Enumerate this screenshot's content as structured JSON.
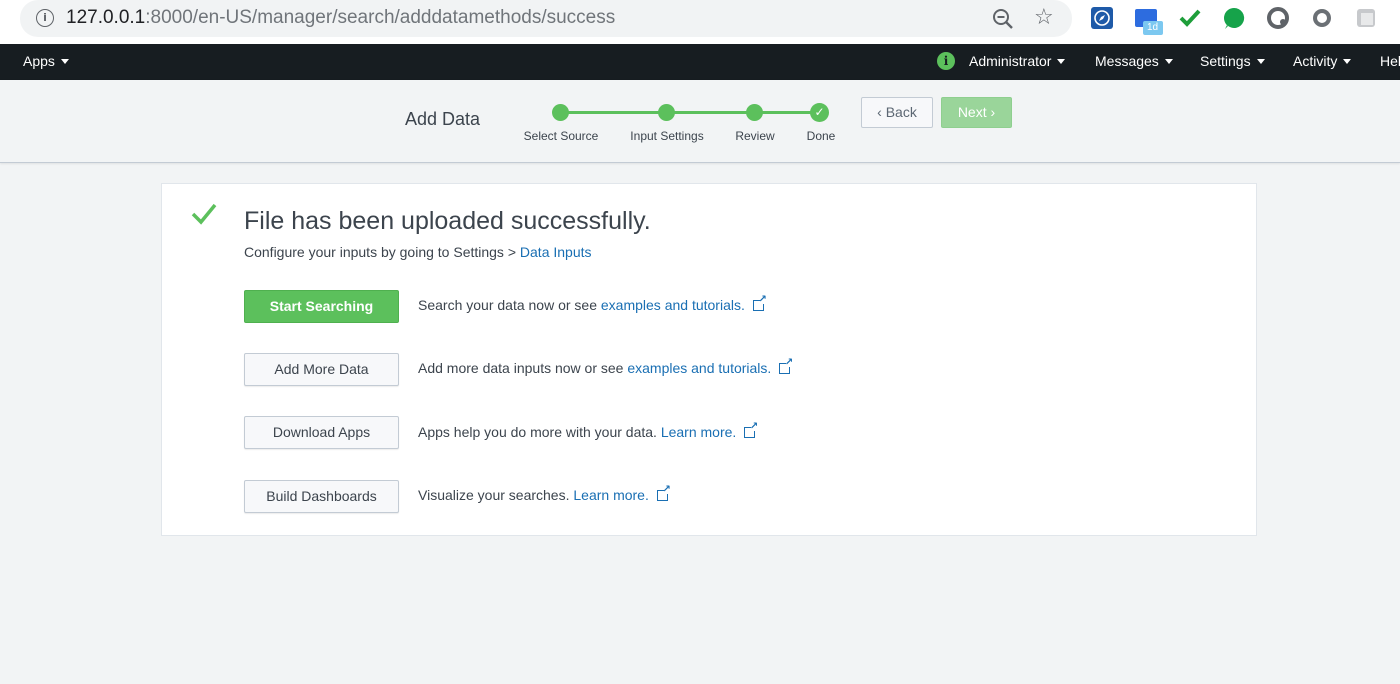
{
  "browser": {
    "url_host": "127.0.0.1",
    "url_rest": ":8000/en-US/manager/search/adddatamethods/success",
    "extension_badge": "1d"
  },
  "topnav": {
    "apps": "Apps",
    "administrator": "Administrator",
    "messages": "Messages",
    "settings": "Settings",
    "activity": "Activity",
    "help": "Help"
  },
  "wizard": {
    "title": "Add Data",
    "steps": [
      "Select Source",
      "Input Settings",
      "Review",
      "Done"
    ],
    "back_label": "Back",
    "next_label": "Next",
    "accent_color": "#5cc05c"
  },
  "panel": {
    "title": "File has been uploaded successfully.",
    "subtitle_prefix": "Configure your inputs by going to Settings > ",
    "subtitle_link": "Data Inputs",
    "actions": [
      {
        "label": "Start Searching",
        "desc": "Search your data now or see ",
        "link": "examples and tutorials."
      },
      {
        "label": "Add More Data",
        "desc": "Add more data inputs now or see ",
        "link": "examples and tutorials."
      },
      {
        "label": "Download Apps",
        "desc": "Apps help you do more with your data. ",
        "link": "Learn more."
      },
      {
        "label": "Build Dashboards",
        "desc": "Visualize your searches. ",
        "link": "Learn more."
      }
    ]
  }
}
